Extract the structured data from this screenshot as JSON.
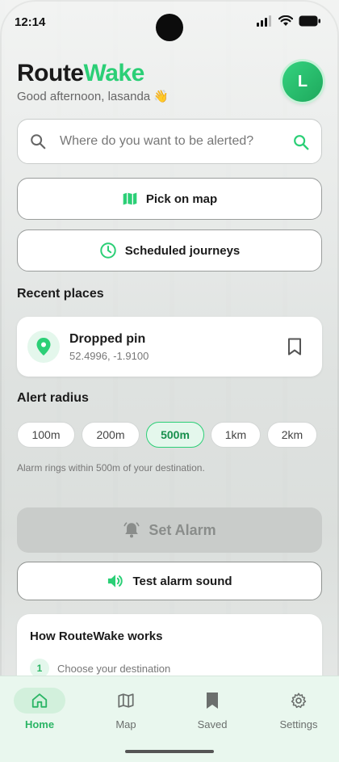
{
  "status_bar": {
    "time": "12:14"
  },
  "header": {
    "title_part1": "Route",
    "title_part2": "Wake",
    "greeting": "Good afternoon, lasanda 👋",
    "avatar_initial": "L"
  },
  "search": {
    "placeholder": "Where do you want to be alerted?"
  },
  "actions": {
    "pick_on_map": "Pick on map",
    "scheduled_journeys": "Scheduled journeys"
  },
  "recent": {
    "title": "Recent places",
    "items": [
      {
        "name": "Dropped pin",
        "coords": "52.4996, -1.9100"
      }
    ]
  },
  "alert_radius": {
    "title": "Alert radius",
    "options": [
      "100m",
      "200m",
      "500m",
      "1km",
      "2km"
    ],
    "selected": "500m",
    "hint": "Alarm rings within 500m of your destination."
  },
  "buttons": {
    "set_alarm": "Set Alarm",
    "test_sound": "Test alarm sound"
  },
  "how_it_works": {
    "title": "How RouteWake works",
    "steps": [
      {
        "num": "1",
        "text": "Choose your destination"
      }
    ]
  },
  "nav": [
    {
      "label": "Home",
      "icon": "home-icon",
      "active": true
    },
    {
      "label": "Map",
      "icon": "map-icon",
      "active": false
    },
    {
      "label": "Saved",
      "icon": "bookmark-icon",
      "active": false
    },
    {
      "label": "Settings",
      "icon": "gear-icon",
      "active": false
    }
  ],
  "colors": {
    "accent": "#2bcf76",
    "accent_dark": "#178f4c",
    "disabled": "#c9ccca"
  }
}
